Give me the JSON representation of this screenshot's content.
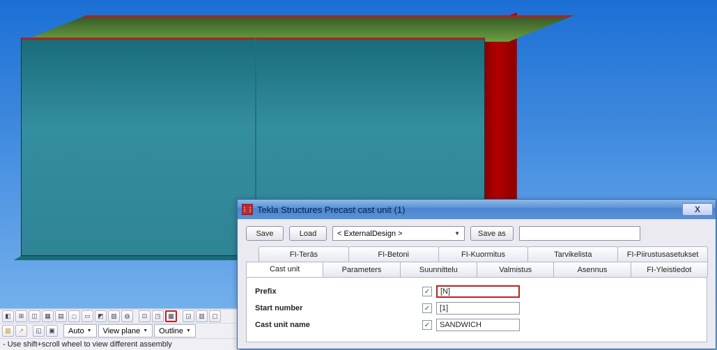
{
  "bottom": {
    "combo1": "Auto",
    "combo2": "View plane",
    "combo3": "Outline",
    "status": "- Use shift+scroll wheel to view different assembly"
  },
  "dialog": {
    "title": "Tekla Structures  Precast cast unit (1)",
    "buttons": {
      "save": "Save",
      "load": "Load",
      "saveas": "Save as"
    },
    "preset": "< ExternalDesign >",
    "tabs_row1": [
      "FI-Teräs",
      "FI-Betoni",
      "FI-Kuormitus",
      "Tarvikelista",
      "FI-Piirustusasetukset"
    ],
    "tabs_row2": [
      "Cast unit",
      "Parameters",
      "Suunnittelu",
      "Valmistus",
      "Asennus",
      "FI-Yleistiedot"
    ],
    "fields": {
      "prefix_label": "Prefix",
      "prefix_value": "[N]",
      "startnum_label": "Start number",
      "startnum_value": "[1]",
      "name_label": "Cast unit name",
      "name_value": "SANDWICH"
    }
  }
}
